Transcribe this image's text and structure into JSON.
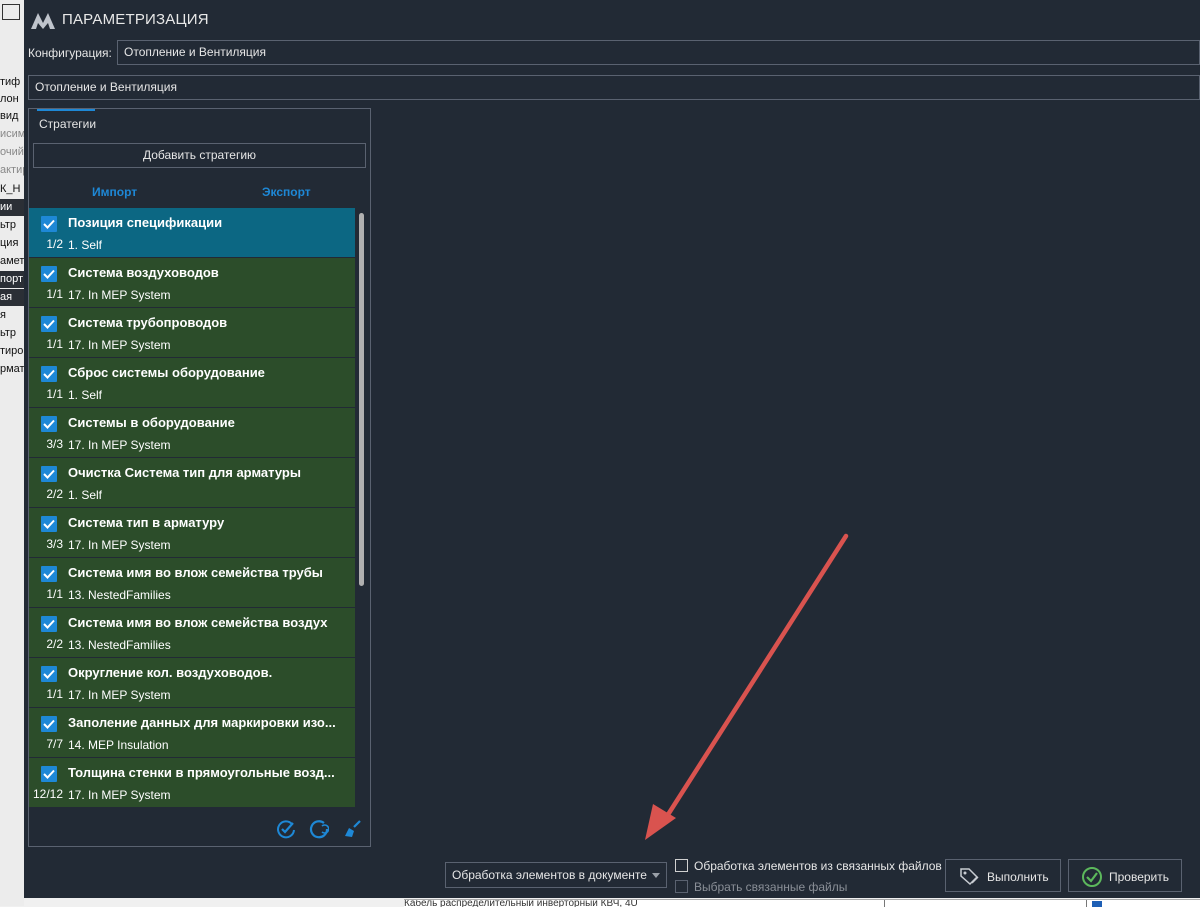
{
  "background_app": {
    "rows": [
      "тиф",
      "лон",
      "вид",
      "исим",
      "очий",
      "актир",
      "К_Н",
      "ии",
      "ьтр",
      "ция",
      "аметр",
      "порт",
      "ая",
      "я",
      "ьтр",
      "тиро",
      "рмат"
    ]
  },
  "window": {
    "title": "ПАРАМЕТРИЗАЦИЯ",
    "logo_icon": "logo-icon"
  },
  "config": {
    "label": "Конфигурация:",
    "value": "Отопление и Вентиляция",
    "tab_value": "Отопление и Вентиляция"
  },
  "strategies": {
    "tab_label": "Стратегии",
    "add_button": "Добавить стратегию",
    "import_link": "Импорт",
    "export_link": "Экспорт",
    "items": [
      {
        "name": "Позиция спецификации",
        "count": "1/2",
        "source": "1. Self",
        "checked": true,
        "selected": true
      },
      {
        "name": "Система воздуховодов",
        "count": "1/1",
        "source": "17. In MEP System",
        "checked": true,
        "selected": false
      },
      {
        "name": "Система трубопроводов",
        "count": "1/1",
        "source": "17. In MEP System",
        "checked": true,
        "selected": false
      },
      {
        "name": "Сброс системы оборудование",
        "count": "1/1",
        "source": "1. Self",
        "checked": true,
        "selected": false
      },
      {
        "name": "Системы в оборудование",
        "count": "3/3",
        "source": "17. In MEP System",
        "checked": true,
        "selected": false
      },
      {
        "name": "Очистка Система тип для арматуры",
        "count": "2/2",
        "source": "1. Self",
        "checked": true,
        "selected": false
      },
      {
        "name": "Система тип в арматуру",
        "count": "3/3",
        "source": "17. In MEP System",
        "checked": true,
        "selected": false
      },
      {
        "name": "Система имя во влож семейства трубы",
        "count": "1/1",
        "source": "13. NestedFamilies",
        "checked": true,
        "selected": false
      },
      {
        "name": "Система имя во влож семейства воздух",
        "count": "2/2",
        "source": "13. NestedFamilies",
        "checked": true,
        "selected": false
      },
      {
        "name": "Округление кол. воздуховодов.",
        "count": "1/1",
        "source": "17. In MEP System",
        "checked": true,
        "selected": false
      },
      {
        "name": "Заполение данных для маркировки изо...",
        "count": "7/7",
        "source": "14. MEP Insulation",
        "checked": true,
        "selected": false
      },
      {
        "name": "Толщина стенки в прямоугольные возд...",
        "count": "12/12",
        "source": "17. In MEP System",
        "checked": true,
        "selected": false
      }
    ],
    "tools": [
      "check-all-icon",
      "uncheck-all-icon",
      "clear-icon"
    ]
  },
  "bottom": {
    "mode_value": "Обработка элементов в документе",
    "linked_files_checkbox": "Обработка элементов из связанных файлов",
    "select_linked_checkbox": "Выбрать связанные файлы",
    "run_button": "Выполнить",
    "check_button": "Проверить"
  },
  "colors": {
    "background": "#222a35",
    "accent": "#1e88d6",
    "item_green": "#2c4d2a",
    "item_selected": "#0c6783",
    "annotation_arrow": "#d9534f"
  },
  "background_bottom_text": "Кабель распределительный инверторный КВЧ, 4U"
}
